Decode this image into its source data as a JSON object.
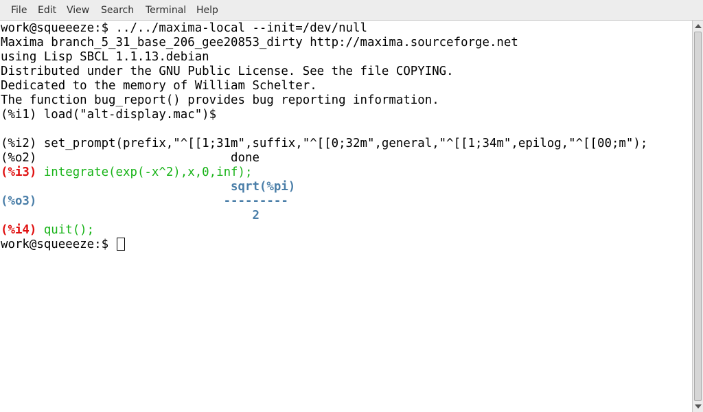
{
  "menu": {
    "file": "File",
    "edit": "Edit",
    "view": "View",
    "search": "Search",
    "terminal": "Terminal",
    "help": "Help"
  },
  "terminal": {
    "line1": "work@squeeeze:$ ../../maxima-local --init=/dev/null",
    "line2": "Maxima branch_5_31_base_206_gee20853_dirty http://maxima.sourceforge.net",
    "line3": "using Lisp SBCL 1.1.13.debian",
    "line4": "Distributed under the GNU Public License. See the file COPYING.",
    "line5": "Dedicated to the memory of William Schelter.",
    "line6": "The function bug_report() provides bug reporting information.",
    "line7": "(%i1) load(\"alt-display.mac\")$",
    "line9": "(%i2) set_prompt(prefix,\"^[[1;31m\",suffix,\"^[[0;32m\",general,\"^[[1;34m\",epilog,\"^[[00;m\");",
    "line10": "(%o2)                           done",
    "i3_prompt": "(%i3)",
    "i3_input": " integrate(exp(-x^2),x,0,inf);",
    "o3_numerator": "                                sqrt(%pi)",
    "o3_label": "(%o3)",
    "o3_bar": "                          ---------",
    "o3_denominator": "                                   2",
    "i4_prompt": "(%i4)",
    "i4_input": " quit();",
    "final_prompt": "work@squeeeze:$ "
  },
  "colors": {
    "prefix": "#e01010",
    "suffix": "#17b317",
    "general": "#4a7ea8"
  }
}
